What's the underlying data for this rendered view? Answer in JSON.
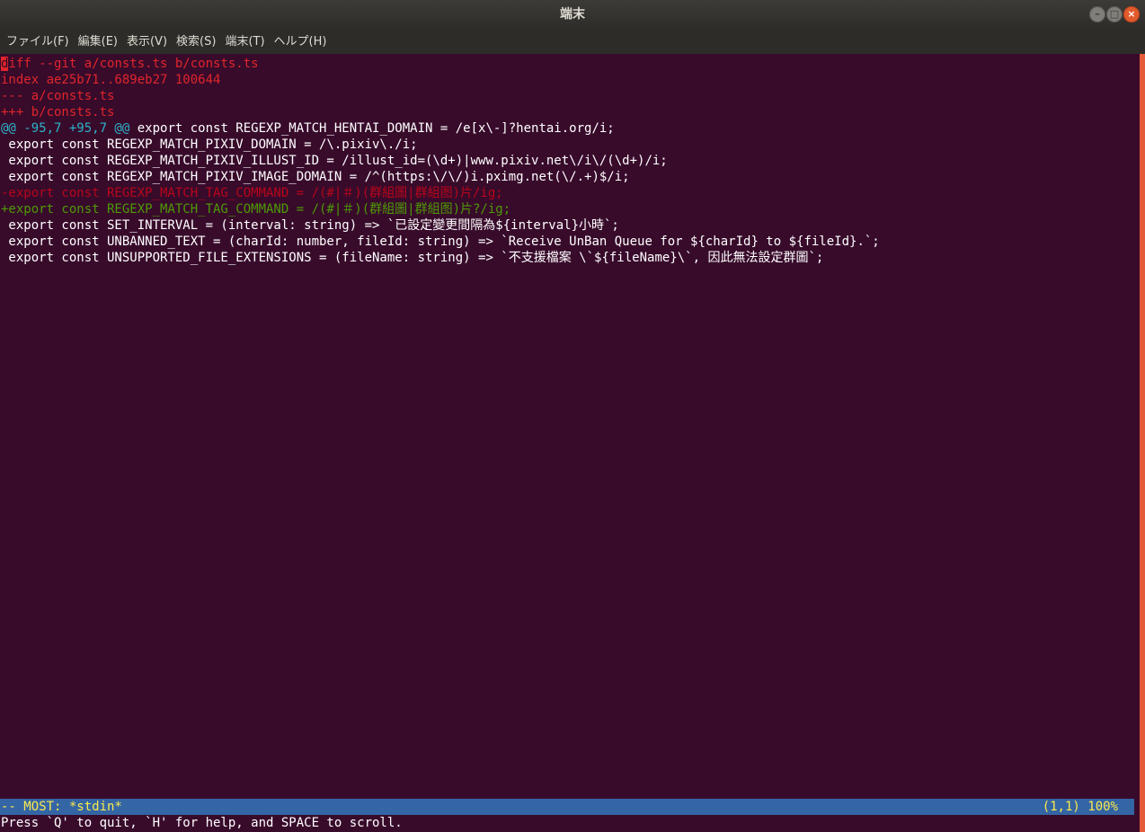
{
  "window": {
    "title": "端末"
  },
  "menubar": {
    "items": [
      "ファイル(F)",
      "編集(E)",
      "表示(V)",
      "検索(S)",
      "端末(T)",
      "ヘルプ(H)"
    ]
  },
  "terminal": {
    "cursor_char": "d",
    "first_line_rest": "iff --git a/consts.ts b/consts.ts",
    "index_line": "index ae25b71..689eb27 100644",
    "minus_file": "--- a/consts.ts",
    "plus_file": "+++ b/consts.ts",
    "hunk_header": "@@ -95,7 +95,7 @@",
    "hunk_context": " export const REGEXP_MATCH_HENTAI_DOMAIN = /e[x\\-]?hentai.org/i;",
    "context_lines": [
      " export const REGEXP_MATCH_PIXIV_DOMAIN = /\\.pixiv\\./i;",
      " export const REGEXP_MATCH_PIXIV_ILLUST_ID = /illust_id=(\\d+)|www.pixiv.net\\/i\\/(\\d+)/i;",
      " export const REGEXP_MATCH_PIXIV_IMAGE_DOMAIN = /^(https:\\/\\/)i.pximg.net(\\/.+)$/i;"
    ],
    "removed_line": "-export const REGEXP_MATCH_TAG_COMMAND = /(#|＃)(群組圖|群組图)片/ig;",
    "added_line": "+export const REGEXP_MATCH_TAG_COMMAND = /(#|＃)(群組圖|群組图)片?/ig;",
    "trailing_lines": [
      " export const SET_INTERVAL = (interval: string) => `已設定變更間隔為${interval}小時`;",
      " export const UNBANNED_TEXT = (charId: number, fileId: string) => `Receive UnBan Queue for ${charId} to ${fileId}.`;",
      " export const UNSUPPORTED_FILE_EXTENSIONS = (fileName: string) => `不支援檔案 \\`${fileName}\\`, 因此無法設定群圖`;"
    ]
  },
  "status": {
    "left": "-- MOST: *stdin*",
    "right": "(1,1) 100%"
  },
  "prompt": "Press `Q' to quit, `H' for help, and SPACE to scroll."
}
